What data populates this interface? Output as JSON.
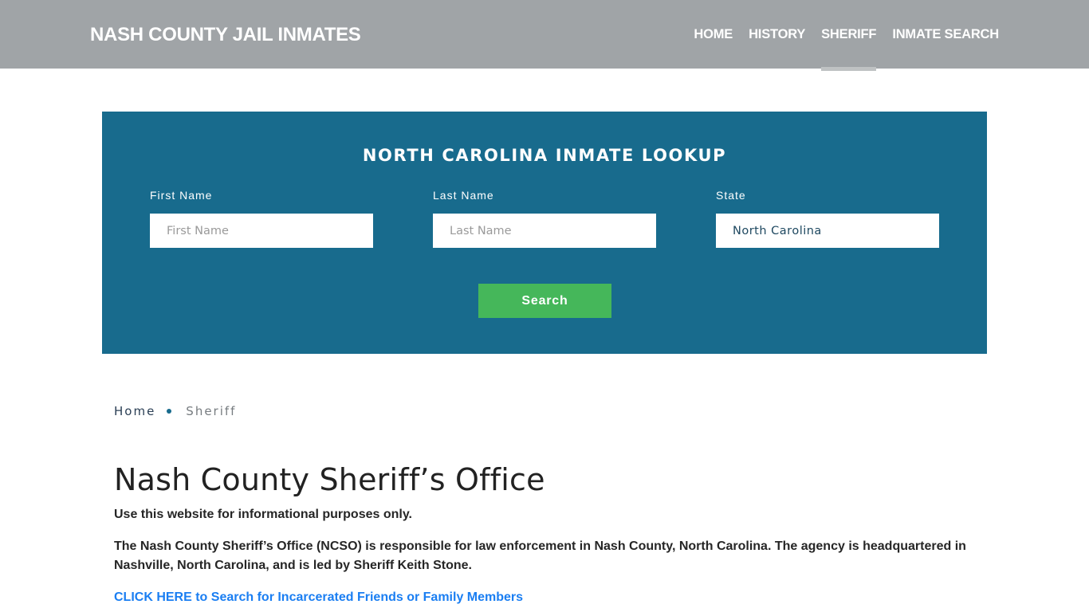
{
  "header": {
    "brand": "NASH COUNTY JAIL INMATES",
    "nav": [
      {
        "label": "HOME",
        "active": false
      },
      {
        "label": "HISTORY",
        "active": false
      },
      {
        "label": "SHERIFF",
        "active": true
      },
      {
        "label": "INMATE SEARCH",
        "active": false
      }
    ]
  },
  "lookup": {
    "title": "NORTH CAROLINA INMATE LOOKUP",
    "first_name": {
      "label": "First Name",
      "placeholder": "First Name",
      "value": ""
    },
    "last_name": {
      "label": "Last Name",
      "placeholder": "Last Name",
      "value": ""
    },
    "state": {
      "label": "State",
      "value": "North Carolina"
    },
    "search_label": "Search"
  },
  "breadcrumb": {
    "items": [
      "Home",
      "Sheriff"
    ]
  },
  "main": {
    "title": "Nash County Sheriff’s Office",
    "disclaimer": "Use this website for informational purposes only.",
    "description": "The Nash County Sheriff’s Office (NCSO) is responsible for law enforcement in Nash County, North Carolina. The agency is headquartered in Nashville, North Carolina, and is led by Sheriff Keith Stone.",
    "cta_link": "CLICK HERE to Search for Incarcerated Friends or Family Members"
  },
  "colors": {
    "header_bg": "#a0a4a7",
    "lookup_bg": "#186b8d",
    "search_button": "#45b75a",
    "link": "#1a7ef2"
  }
}
